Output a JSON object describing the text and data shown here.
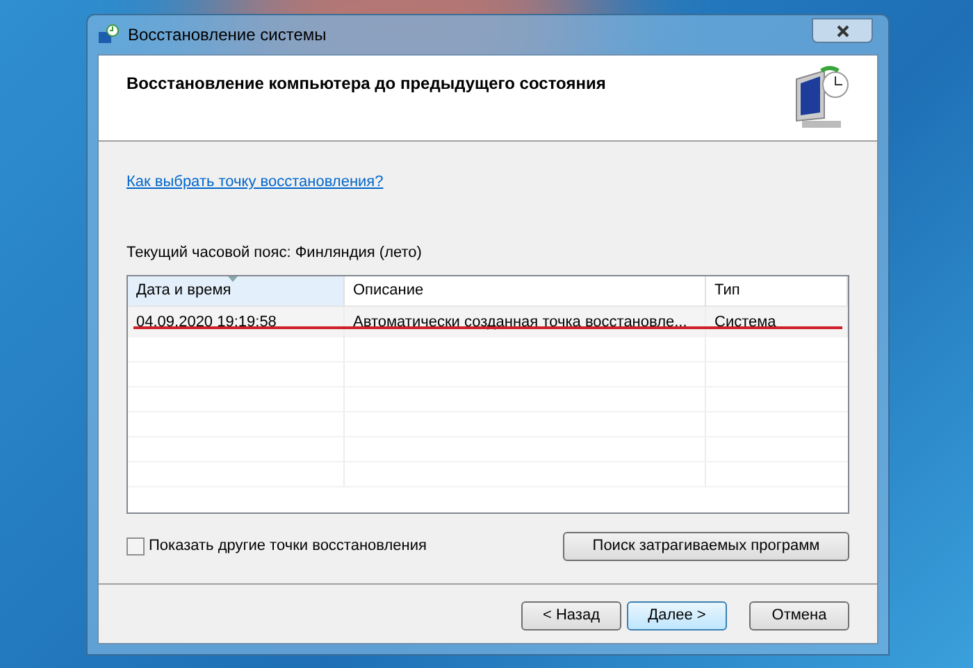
{
  "window": {
    "title": "Восстановление системы"
  },
  "header": {
    "title": "Восстановление компьютера до предыдущего состояния"
  },
  "help_link": "Как выбрать точку восстановления?",
  "timezone": "Текущий часовой пояс: Финляндия (лето)",
  "table": {
    "columns": [
      {
        "label": "Дата и время",
        "sorted": true
      },
      {
        "label": "Описание",
        "sorted": false
      },
      {
        "label": "Тип",
        "sorted": false
      }
    ],
    "rows": [
      {
        "cells": [
          "04.09.2020 19:19:58",
          "Автоматически созданная точка восстановле...",
          "Система"
        ],
        "underlined": true
      }
    ]
  },
  "show_more": {
    "label": "Показать другие точки восстановления",
    "checked": false
  },
  "scan_button": "Поиск затрагиваемых программ",
  "buttons": [
    {
      "label": "< Назад",
      "default": false
    },
    {
      "label": "Далее >",
      "default": true
    },
    {
      "label": "Отмена",
      "default": false
    }
  ]
}
